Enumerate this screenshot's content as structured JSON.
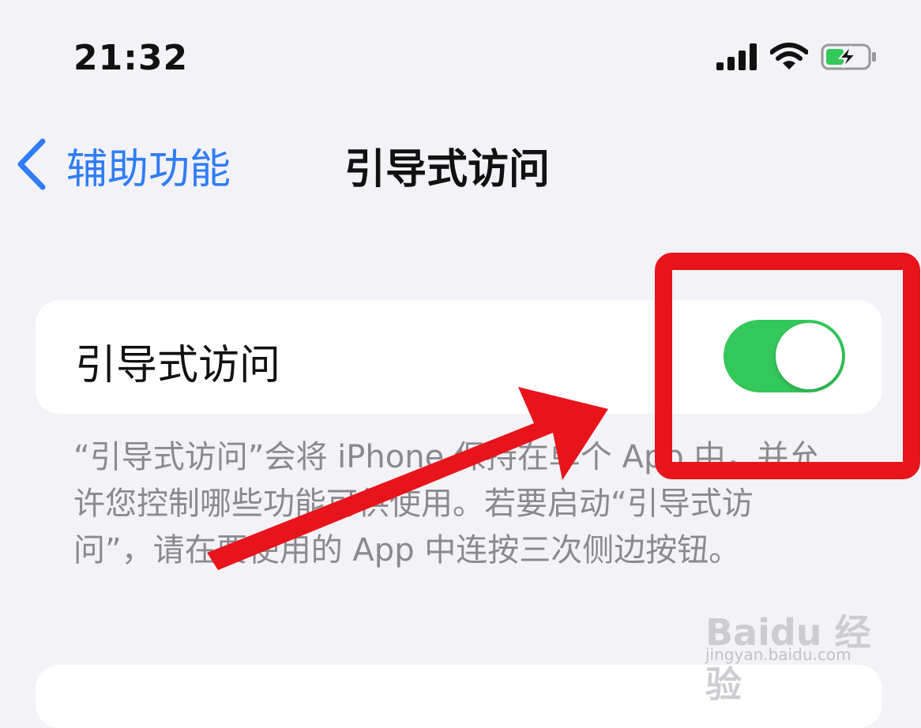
{
  "status_bar": {
    "time": "21:32",
    "icons": [
      "signal-icon",
      "wifi-icon",
      "battery-charging-icon"
    ]
  },
  "nav": {
    "back_label": "辅助功能",
    "title": "引导式访问"
  },
  "settings": {
    "guided_access_label": "引导式访问",
    "guided_access_enabled": true,
    "description": "“引导式访问”会将 iPhone 保持在单个 App 中，并允许您控制哪些功能可供使用。若要启动“引导式访问”，请在要使用的 App 中连按三次侧边按钮。"
  },
  "watermark": {
    "brand": "Baidu 经验",
    "url": "jingyan.baidu.com"
  },
  "colors": {
    "background": "#F2F2F7",
    "accent_blue": "#2F7CF6",
    "toggle_on": "#34C759",
    "annotation_red": "#E8141B",
    "description_gray": "#8A8A8E"
  }
}
